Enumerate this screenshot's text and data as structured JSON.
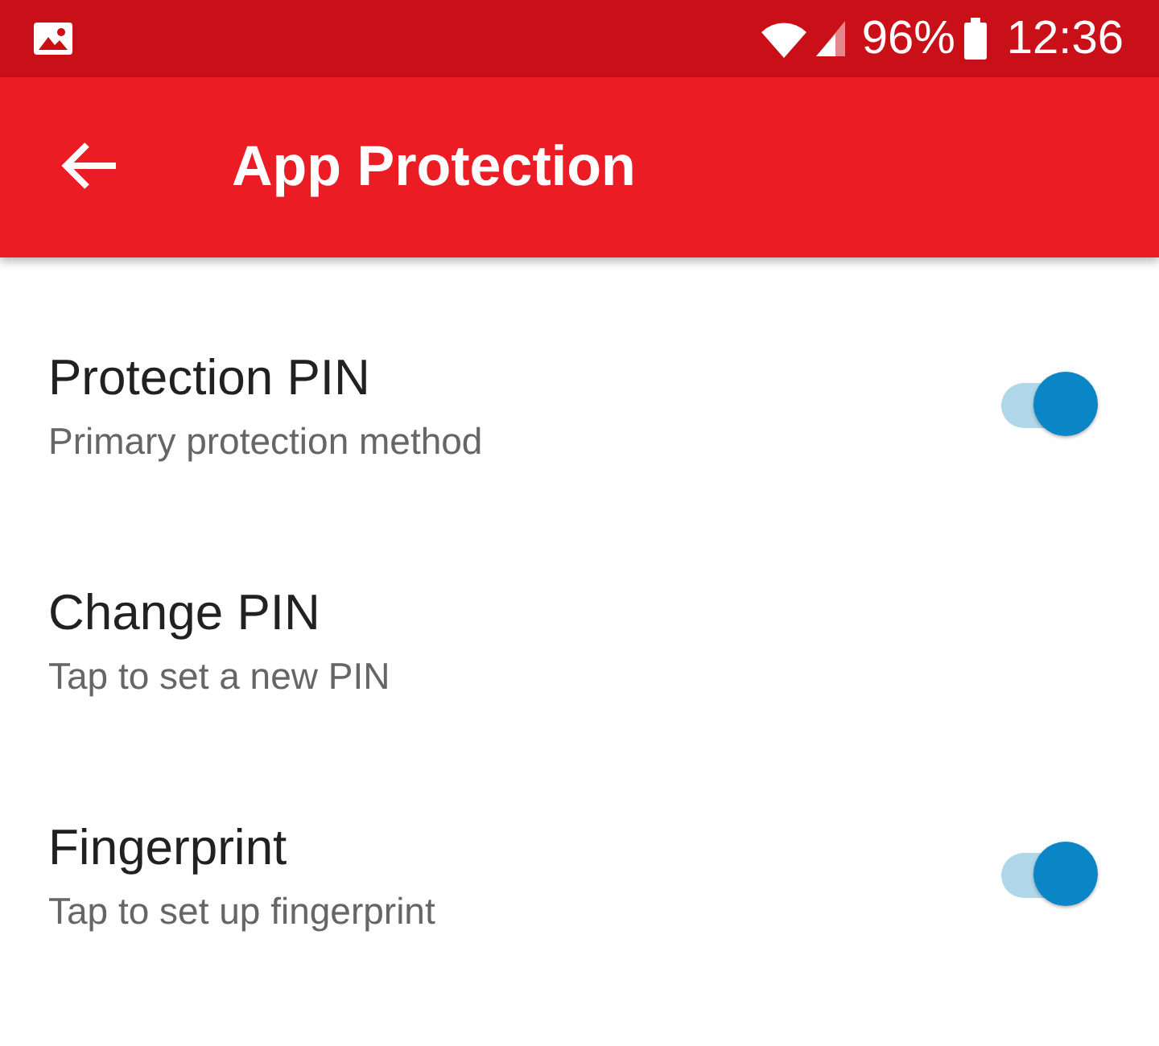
{
  "status_bar": {
    "battery": "96%",
    "time": "12:36"
  },
  "app_bar": {
    "title": "App Protection"
  },
  "settings": [
    {
      "kind": "toggle",
      "title": "Protection PIN",
      "subtitle": "Primary protection method",
      "on": true
    },
    {
      "kind": "plain",
      "title": "Change PIN",
      "subtitle": "Tap to set a new PIN"
    },
    {
      "kind": "toggle",
      "title": "Fingerprint",
      "subtitle": "Tap to set up fingerprint",
      "on": true
    }
  ]
}
